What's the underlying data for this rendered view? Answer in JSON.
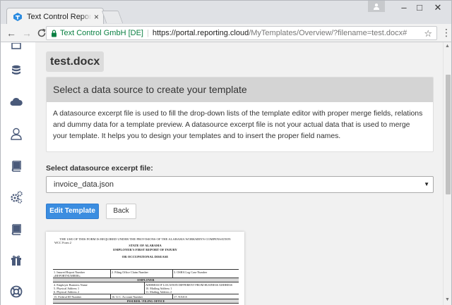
{
  "browser": {
    "tab_title": "Text Control ReportingCl",
    "tab_close": "×",
    "window_controls": {
      "minimize": "–",
      "maximize": "□",
      "close": "✕"
    },
    "nav": {
      "back": "←",
      "forward": "→",
      "reload": "C"
    },
    "omnibox": {
      "secure_label": "Text Control GmbH [DE]",
      "separator": "|",
      "url_host": "https://portal.reporting.cloud",
      "url_path": "/MyTemplates/Overview/?filename=test.docx#"
    },
    "bookmark": "☆",
    "menu": "⋮",
    "favicon_color": "#2b8be0"
  },
  "sidebar": {
    "icons": [
      "database-icon",
      "cloud-icon",
      "user-icon",
      "book-icon",
      "gears-icon",
      "book-icon",
      "gift-icon",
      "lifebuoy-icon"
    ]
  },
  "main": {
    "filename": "test.docx",
    "card": {
      "heading": "Select a data source to create your template",
      "body": "A datasource excerpt file is used to fill the drop-down lists of the template editor with proper merge fields, relations and dummy data for a template preview. A datasource excerpt file is not your actual data that is used to merge your template. It helps you to design your templates and to insert the proper field names."
    },
    "select_label": "Select datasource excerpt file:",
    "select_value": "invoice_data.json",
    "edit_button": "Edit Template",
    "back_button": "Back",
    "accent_color": "#3b8de0"
  },
  "preview": {
    "top_line": "THE USE OF THIS FORM IS REQUIRED UNDER THE PROVISIONS OF THE ALABAMA WORKMEN'S COMPENSATION",
    "form_no": "WCC Form 2",
    "state": "STATE OF ALABAMA",
    "report_title": "EMPLOYER'S FIRST REPORT OF INJURY",
    "or_line": "OR OCCUPATIONAL DISEASE",
    "row1": [
      "1. Insured Report Number",
      "2. Filing Office Claim Number",
      "3. OSHA Log Case Number"
    ],
    "merge_field": "«REPORTNUMBER»",
    "band_employer": "EMPLOYER",
    "row2_left": [
      "4. Employer Business Name",
      "5. Physical Address 1",
      "6. Physical Address 2"
    ],
    "row2_right": [
      "ADDRESS IF LOCATION DIFFERENT FROM BUSINESS ADDRESS",
      "10. Mailing Address 1",
      "11. Mailing Address 2"
    ],
    "row3": [
      "15. Federal ID Number",
      "16. U.C. Account Number",
      "17. NAICS"
    ],
    "band_insurer": "INSURER / FILING OFFICE"
  }
}
